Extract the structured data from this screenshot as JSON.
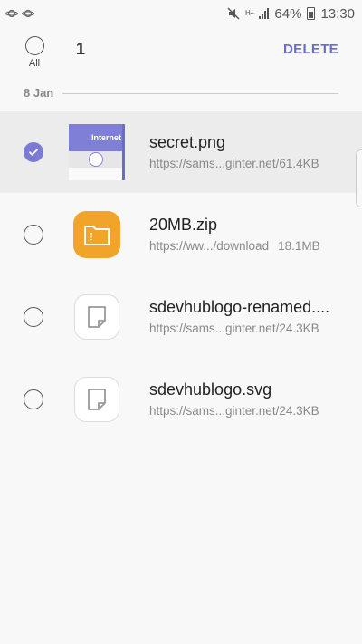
{
  "status_bar": {
    "network_type": "H+",
    "battery": "64%",
    "time": "13:30"
  },
  "toolbar": {
    "select_all_label": "All",
    "selected_count": "1",
    "delete_label": "DELETE"
  },
  "section": {
    "date": "8 Jan"
  },
  "items": [
    {
      "name": "secret.png",
      "url": "https://sams...ginter.net/",
      "size": "61.4KB",
      "selected": true
    },
    {
      "name": "20MB.zip",
      "url": "https://ww.../download",
      "size": "18.1MB",
      "selected": false
    },
    {
      "name": "sdevhublogo-renamed....",
      "url": "https://sams...ginter.net/",
      "size": "24.3KB",
      "selected": false
    },
    {
      "name": "sdevhublogo.svg",
      "url": "https://sams...ginter.net/",
      "size": "24.3KB",
      "selected": false
    }
  ],
  "thumbnail": {
    "brand_text": "Internet"
  },
  "colors": {
    "accent": "#6b6bc8",
    "zip_icon": "#f0a52a"
  }
}
